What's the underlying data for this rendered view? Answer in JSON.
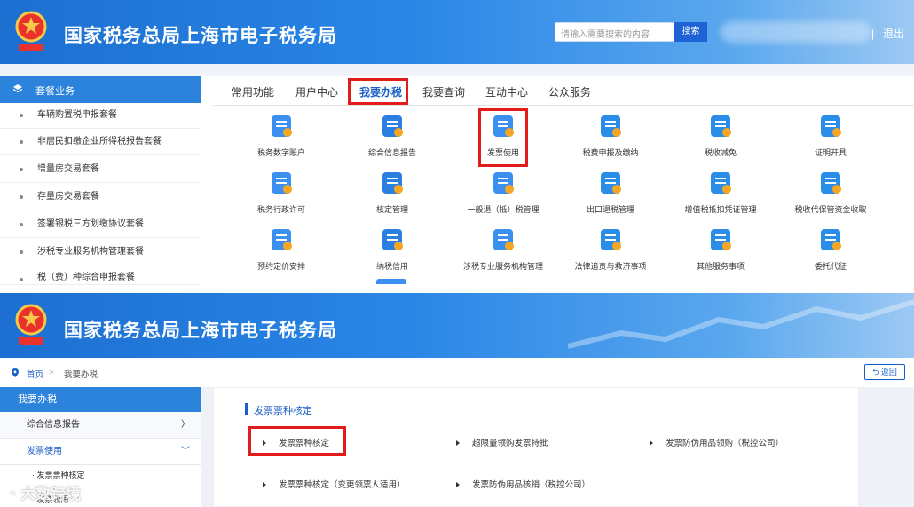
{
  "header": {
    "title": "国家税务总局上海市电子税务局",
    "emblem_text": "中国税务",
    "search_placeholder": "请输入需要搜索的内容",
    "search_button": "搜索",
    "separator": "|",
    "logout": "退出"
  },
  "sidebar": {
    "heading": "套餐业务",
    "items": [
      "车辆购置税申报套餐",
      "非居民扣缴企业所得税报告套餐",
      "增量房交易套餐",
      "存量房交易套餐",
      "签署银税三方划缴协议套餐",
      "涉税专业服务机构管理套餐",
      "税（费）种综合申报套餐"
    ]
  },
  "tabs": [
    "常用功能",
    "用户中心",
    "我要办税",
    "我要查询",
    "互动中心",
    "公众服务"
  ],
  "active_tab": "我要办税",
  "grid": [
    [
      "税务数字账户",
      "综合信息报告",
      "发票使用",
      "税费申报及缴纳",
      "税收减免",
      "证明开具"
    ],
    [
      "税务行政许可",
      "核定管理",
      "一般退（抵）税管理",
      "出口退税管理",
      "增值税抵扣凭证管理",
      "税收代保管资金收取"
    ],
    [
      "预约定价安排",
      "纳税信用",
      "涉税专业服务机构管理",
      "法律追责与救济事项",
      "其他服务事项",
      "委托代征"
    ]
  ],
  "bottom": {
    "breadcrumb": {
      "home": "首页",
      "sep": ">",
      "current": "我要办税"
    },
    "back_button": "返回",
    "menu_heading": "我要办税",
    "menu_items": [
      {
        "label": "综合信息报告",
        "arrow": "〉"
      },
      {
        "label": "发票使用",
        "arrow": "﹀"
      }
    ],
    "sub_items": [
      "发票票种核定",
      "发票领用"
    ],
    "section_title": "发票票种核定",
    "links_row1": [
      "发票票种核定",
      "超限量领购发票特批",
      "发票防伪用品领购（税控公司）"
    ],
    "links_row2": [
      "发票票种核定（变更领票人适用）",
      "发票防伪用品核销（税控公司）"
    ]
  },
  "watermark": "大数跨境",
  "colors": {
    "header_blue": "#2a86e6",
    "accent": "#1a5fc8",
    "highlight_red": "#e21b1b"
  }
}
